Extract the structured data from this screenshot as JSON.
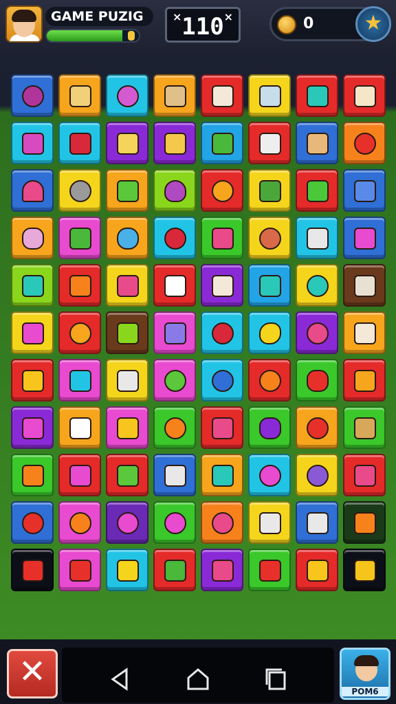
{
  "header": {
    "title": "GAME PUZIG",
    "xp_progress": 0.82,
    "score": "× 1 1 0",
    "score_display": "110",
    "score_mark_left": "×",
    "score_mark_right": "×",
    "coins": "0",
    "avatar_icon": "player-avatar",
    "coin_icon": "coin-icon",
    "star_icon": "star-icon"
  },
  "board": {
    "rows": 11,
    "cols": 8,
    "tiles": [
      [
        {
          "bg": "#2f6fd6",
          "icon": "plum",
          "c": "#b0359a"
        },
        {
          "bg": "#f7a51c",
          "icon": "cup",
          "c": "#f1d07a"
        },
        {
          "bg": "#22c4e6",
          "icon": "candy",
          "c": "#d35ad0"
        },
        {
          "bg": "#f7a51c",
          "icon": "bowl",
          "c": "#e0c089"
        },
        {
          "bg": "#e52a2a",
          "icon": "sign",
          "c": "#f4e8d8"
        },
        {
          "bg": "#f5d51c",
          "icon": "pot",
          "c": "#c8ddea"
        },
        {
          "bg": "#e52a2a",
          "icon": "shell",
          "c": "#2ac8b8"
        },
        {
          "bg": "#e52a2a",
          "icon": "arch",
          "c": "#f5e6c8"
        }
      ],
      [
        {
          "bg": "#22c4e6",
          "icon": "jar",
          "c": "#d84ac0"
        },
        {
          "bg": "#22c4e6",
          "icon": "flower",
          "c": "#d8283a"
        },
        {
          "bg": "#8a2ad6",
          "icon": "tool",
          "c": "#f4d45a"
        },
        {
          "bg": "#8a2ad6",
          "icon": "bottle",
          "c": "#f4c84a"
        },
        {
          "bg": "#22a4e6",
          "icon": "leaf",
          "c": "#4ab83a"
        },
        {
          "bg": "#e52a2a",
          "icon": "box",
          "c": "#eeeeee"
        },
        {
          "bg": "#2f6fd6",
          "icon": "pan",
          "c": "#e8b87a"
        },
        {
          "bg": "#f7821c",
          "icon": "swirl",
          "c": "#e8302a"
        }
      ],
      [
        {
          "bg": "#2f6fd6",
          "icon": "umbrella",
          "c": "#e84a8a"
        },
        {
          "bg": "#f5d51c",
          "icon": "spiral",
          "c": "#9a9a9a"
        },
        {
          "bg": "#f7a51c",
          "icon": "stick",
          "c": "#5ac83a"
        },
        {
          "bg": "#8ad61c",
          "icon": "onion",
          "c": "#b04ac0"
        },
        {
          "bg": "#e52a2a",
          "icon": "orange",
          "c": "#f7a51c"
        },
        {
          "bg": "#f5d51c",
          "icon": "pickle",
          "c": "#4aa83a"
        },
        {
          "bg": "#e52a2a",
          "icon": "cactus",
          "c": "#4ac83a"
        },
        {
          "bg": "#2f6fd6",
          "icon": "plane",
          "c": "#5a8ae8"
        }
      ],
      [
        {
          "bg": "#f7a51c",
          "icon": "grapes",
          "c": "#e8a8d8"
        },
        {
          "bg": "#e84ad0",
          "icon": "potion",
          "c": "#4ab83a"
        },
        {
          "bg": "#f7a51c",
          "icon": "blob",
          "c": "#4ab0e8"
        },
        {
          "bg": "#22c4e6",
          "icon": "cherry",
          "c": "#d8283a"
        },
        {
          "bg": "#3ac82a",
          "icon": "pepper",
          "c": "#e84a8a"
        },
        {
          "bg": "#f5d51c",
          "icon": "face",
          "c": "#d86a4a"
        },
        {
          "bg": "#22c4e6",
          "icon": "radio",
          "c": "#e8e8e8"
        },
        {
          "bg": "#2f6fd6",
          "icon": "cake",
          "c": "#e84ad0"
        }
      ],
      [
        {
          "bg": "#8ad61c",
          "icon": "can",
          "c": "#2ac8b8"
        },
        {
          "bg": "#e52a2a",
          "icon": "carrot",
          "c": "#f7821c"
        },
        {
          "bg": "#f5d51c",
          "icon": "drum",
          "c": "#e84a8a"
        },
        {
          "bg": "#e52a2a",
          "icon": "dice",
          "c": "#ffffff"
        },
        {
          "bg": "#8a2ad6",
          "icon": "frame",
          "c": "#f4e8d8"
        },
        {
          "bg": "#22a4e6",
          "icon": "vase",
          "c": "#2ac8b8"
        },
        {
          "bg": "#f5d51c",
          "icon": "ring",
          "c": "#2ac8b8"
        },
        {
          "bg": "#6a3a1c",
          "icon": "bowl",
          "c": "#e8e0d0"
        }
      ],
      [
        {
          "bg": "#f5d51c",
          "icon": "jar",
          "c": "#e84ad0"
        },
        {
          "bg": "#e52a2a",
          "icon": "sun",
          "c": "#f7a51c"
        },
        {
          "bg": "#6a3a1c",
          "icon": "bottle",
          "c": "#8ad61c"
        },
        {
          "bg": "#e84ad0",
          "icon": "pencil",
          "c": "#8a7ae8"
        },
        {
          "bg": "#22c4e6",
          "icon": "face",
          "c": "#d8283a"
        },
        {
          "bg": "#22c4e6",
          "icon": "bean",
          "c": "#f5d51c"
        },
        {
          "bg": "#8a2ad6",
          "icon": "beet",
          "c": "#e84a8a"
        },
        {
          "bg": "#f7a51c",
          "icon": "box",
          "c": "#f4e8d8"
        }
      ],
      [
        {
          "bg": "#e52a2a",
          "icon": "bread",
          "c": "#f7c51c"
        },
        {
          "bg": "#e84ad0",
          "icon": "cup",
          "c": "#22c4e6"
        },
        {
          "bg": "#f5d51c",
          "icon": "lamp",
          "c": "#e8e8e8"
        },
        {
          "bg": "#e84ad0",
          "icon": "apple",
          "c": "#5ac83a"
        },
        {
          "bg": "#22c4e6",
          "icon": "roll",
          "c": "#2f6fd6"
        },
        {
          "bg": "#e52a2a",
          "icon": "apple",
          "c": "#f7821c"
        },
        {
          "bg": "#3ac82a",
          "icon": "mouth",
          "c": "#e8302a"
        },
        {
          "bg": "#e52a2a",
          "icon": "tag",
          "c": "#f7a51c"
        }
      ],
      [
        {
          "bg": "#8a2ad6",
          "icon": "stick",
          "c": "#e84ad0"
        },
        {
          "bg": "#f7a51c",
          "icon": "hat",
          "c": "#ffffff"
        },
        {
          "bg": "#e84ad0",
          "icon": "box",
          "c": "#f7c51c"
        },
        {
          "bg": "#3ac82a",
          "icon": "face",
          "c": "#f7821c"
        },
        {
          "bg": "#e52a2a",
          "icon": "box",
          "c": "#e84a8a"
        },
        {
          "bg": "#3ac82a",
          "icon": "grapes",
          "c": "#8a2ad6"
        },
        {
          "bg": "#f7a51c",
          "icon": "apple",
          "c": "#e8302a"
        },
        {
          "bg": "#3ac82a",
          "icon": "tool",
          "c": "#d8a85a"
        }
      ],
      [
        {
          "bg": "#3ac82a",
          "icon": "stick",
          "c": "#f7821c"
        },
        {
          "bg": "#e52a2a",
          "icon": "pot",
          "c": "#e84ad0"
        },
        {
          "bg": "#e52a2a",
          "icon": "card",
          "c": "#5ac83a"
        },
        {
          "bg": "#2f6fd6",
          "icon": "phone",
          "c": "#e8e8e8"
        },
        {
          "bg": "#f7a51c",
          "icon": "jar",
          "c": "#2ac8b8"
        },
        {
          "bg": "#22c4e6",
          "icon": "donut",
          "c": "#e84ad0"
        },
        {
          "bg": "#f5d51c",
          "icon": "face",
          "c": "#8a5ad6"
        },
        {
          "bg": "#e52a2a",
          "icon": "card",
          "c": "#e84a8a"
        }
      ],
      [
        {
          "bg": "#2f6fd6",
          "icon": "ring",
          "c": "#e8302a"
        },
        {
          "bg": "#e84ad0",
          "icon": "spiral",
          "c": "#f7821c"
        },
        {
          "bg": "#6a2ab6",
          "icon": "candy",
          "c": "#e84ad0"
        },
        {
          "bg": "#3ac82a",
          "icon": "face",
          "c": "#e84ad0"
        },
        {
          "bg": "#f7821c",
          "icon": "snail",
          "c": "#e84a8a"
        },
        {
          "bg": "#f5d51c",
          "icon": "bone",
          "c": "#e8e8e8"
        },
        {
          "bg": "#2f6fd6",
          "icon": "frame",
          "c": "#e8e8e8"
        },
        {
          "bg": "#1a3a1a",
          "icon": "hammer",
          "c": "#f7821c"
        }
      ],
      [
        {
          "bg": "#0c0f18",
          "icon": "rocket",
          "c": "#e8302a"
        },
        {
          "bg": "#e84ad0",
          "icon": "star",
          "c": "#e8302a"
        },
        {
          "bg": "#22c4e6",
          "icon": "fish",
          "c": "#f5d51c"
        },
        {
          "bg": "#e52a2a",
          "icon": "leaf",
          "c": "#4ab83a"
        },
        {
          "bg": "#8a2ad6",
          "icon": "cake",
          "c": "#e84a8a"
        },
        {
          "bg": "#3ac82a",
          "icon": "pepper",
          "c": "#e8302a"
        },
        {
          "bg": "#e52a2a",
          "icon": "cone",
          "c": "#f7c51c"
        },
        {
          "bg": "#0c0f18",
          "icon": "gold",
          "c": "#f5c51c"
        }
      ]
    ]
  },
  "nav": {
    "back_icon": "back-triangle-icon",
    "home_icon": "home-icon",
    "recents_icon": "recents-icon",
    "close_icon": "close-x-icon",
    "profile_label": "POM6"
  }
}
